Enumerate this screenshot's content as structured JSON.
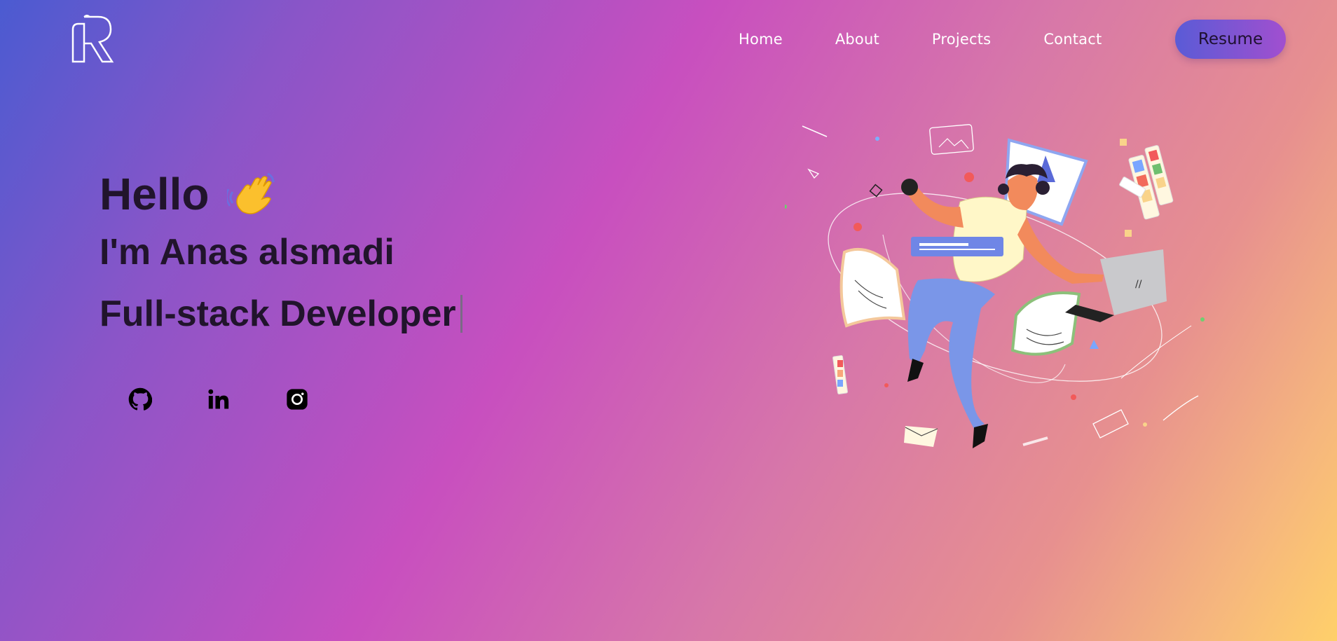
{
  "header": {
    "logo": "rr-logo",
    "nav": [
      "Home",
      "About",
      "Projects",
      "Contact"
    ],
    "resume_label": "Resume"
  },
  "hero": {
    "greeting": "Hello",
    "greeting_icon": "waving-hand-icon",
    "name_line": "I'm Anas alsmadi",
    "role_line": "Full-stack Developer"
  },
  "socials": [
    {
      "icon": "github-icon"
    },
    {
      "icon": "linkedin-icon"
    },
    {
      "icon": "instagram-icon"
    }
  ],
  "colors": {
    "text_dark": "#21142c",
    "nav_text": "#ffffff",
    "resume_start": "#5a5bd6",
    "resume_end": "#a14fcf"
  }
}
